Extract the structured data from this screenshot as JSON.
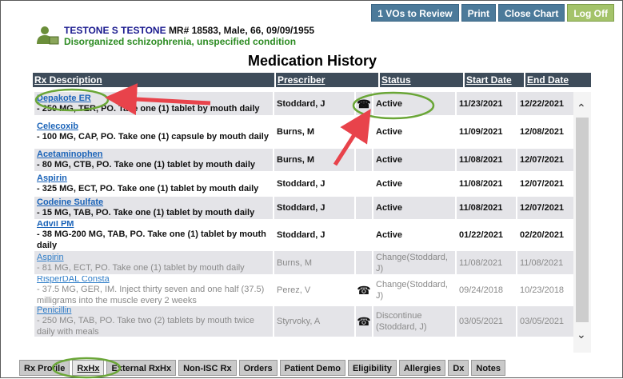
{
  "top_buttons": {
    "review": "1 VOs to Review",
    "print": "Print",
    "close_chart": "Close Chart",
    "log_off": "Log Off"
  },
  "patient": {
    "name": "TESTONE S TESTONE",
    "info": "MR# 18583, Male, 66, 09/09/1955",
    "diagnosis": "Disorganized schizophrenia, unspecified condition",
    "icon": "patient-person-icon"
  },
  "page_title": "Medication History",
  "columns": [
    "Rx Description",
    "Prescriber",
    "Status",
    "Start Date",
    "End Date"
  ],
  "rows": [
    {
      "drug": "Depakote ER",
      "sig": "- 250 MG, TER, PO. Take one (1) tablet by mouth daily",
      "prescriber": "Stoddard, J",
      "phone": true,
      "status": "Active",
      "start": "11/23/2021",
      "end": "12/22/2021",
      "inactive": false
    },
    {
      "drug": "Celecoxib",
      "sig": "- 100 MG, CAP, PO. Take one (1) capsule by mouth daily",
      "prescriber": "Burns, M",
      "phone": false,
      "status": "Active",
      "start": "11/09/2021",
      "end": "12/08/2021",
      "inactive": false
    },
    {
      "drug": "Acetaminophen",
      "sig": "- 80 MG, CTB, PO. Take one (1) tablet by mouth daily",
      "prescriber": "Burns, M",
      "phone": false,
      "status": "Active",
      "start": "11/08/2021",
      "end": "12/07/2021",
      "inactive": false
    },
    {
      "drug": "Aspirin",
      "sig": "- 325 MG, ECT, PO. Take one (1) tablet by mouth daily",
      "prescriber": "Stoddard, J",
      "phone": false,
      "status": "Active",
      "start": "11/08/2021",
      "end": "12/07/2021",
      "inactive": false
    },
    {
      "drug": "Codeine Sulfate",
      "sig": "- 15 MG, TAB, PO. Take one (1) tablet by mouth daily",
      "prescriber": "Stoddard, J",
      "phone": false,
      "status": "Active",
      "start": "11/08/2021",
      "end": "12/07/2021",
      "inactive": false
    },
    {
      "drug": "Advil PM",
      "sig": "- 38 MG-200 MG, TAB, PO. Take one (1) tablet by mouth daily",
      "prescriber": "Stoddard, J",
      "phone": false,
      "status": "Active",
      "start": "01/22/2021",
      "end": "02/20/2021",
      "inactive": false
    },
    {
      "drug": "Aspirin",
      "sig": "- 81 MG, ECT, PO. Take one (1) tablet by mouth daily",
      "prescriber": "Burns, M",
      "phone": false,
      "status": "Change(Stoddard, J)",
      "start": "11/08/2021",
      "end": "11/08/2021",
      "inactive": true
    },
    {
      "drug": "RisperDAL Consta",
      "sig": "- 37.5 MG, GER, IM. Inject thirty seven and one half (37.5) milligrams into the muscle every 2 weeks",
      "prescriber": "Perez, V",
      "phone": true,
      "status": "Change(Stoddard, J)",
      "start": "09/24/2018",
      "end": "10/23/2018",
      "inactive": true
    },
    {
      "drug": "Penicillin",
      "sig": "- 250 MG, TAB, PO. Take two (2) tablets by mouth twice daily with meals",
      "prescriber": "Styrvoky, A",
      "phone": true,
      "status": "Discontinue (Stoddard, J)",
      "start": "03/05/2021",
      "end": "03/05/2021",
      "inactive": true
    }
  ],
  "tabs": [
    "Rx Profile",
    "RxHx",
    "External RxHx",
    "Non-ISC Rx",
    "Orders",
    "Patient Demo",
    "Eligibility",
    "Allergies",
    "Dx",
    "Notes"
  ],
  "active_tab": "RxHx",
  "icons": {
    "phone": "telephone-icon",
    "scroll_up": "chevron-up-icon",
    "scroll_down": "chevron-down-icon"
  },
  "colors": {
    "header_bg": "#3e4c5a",
    "link": "#1a63b8",
    "annotation_arrow": "#e8434b",
    "annotation_circle": "#6aa637",
    "button_blue": "#4c7a9a",
    "button_green": "#a4c36a"
  }
}
